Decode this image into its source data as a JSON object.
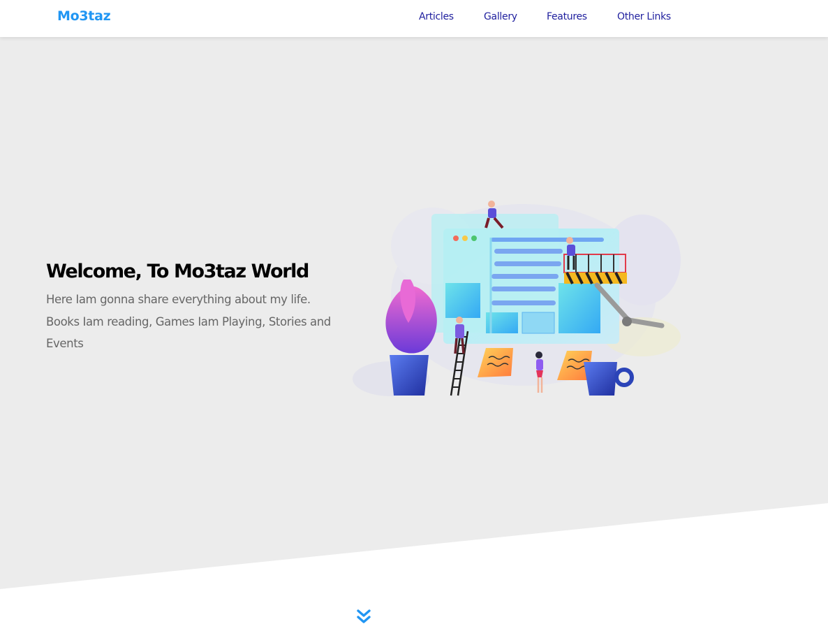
{
  "header": {
    "logo": "Mo3taz",
    "nav": [
      "Articles",
      "Gallery",
      "Features",
      "Other Links"
    ]
  },
  "hero": {
    "title": "Welcome, To Mo3taz World",
    "description": "Here Iam gonna share everything about my life. Books Iam reading, Games Iam Playing, Stories and Events"
  },
  "colors": {
    "accent": "#2196f3",
    "nav_link": "#1f1f9e",
    "landing_bg": "#ececec",
    "text_muted": "#666666"
  },
  "icons": {
    "scroll_down": "angle-double-down-icon"
  }
}
